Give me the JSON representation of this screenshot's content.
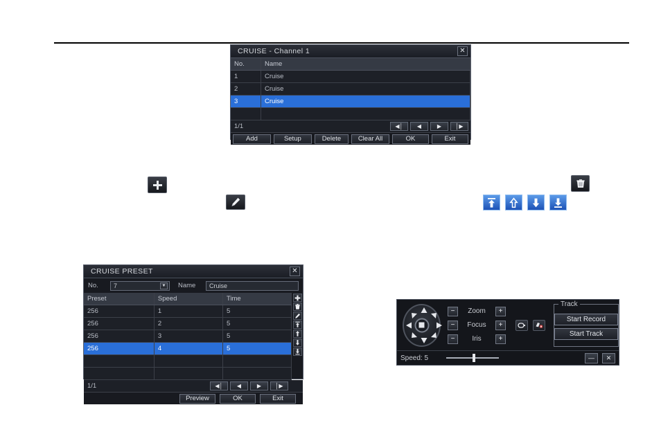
{
  "cruise_dialog": {
    "title": "CRUISE - Channel 1",
    "close_label": "✕",
    "columns": [
      "No.",
      "Name"
    ],
    "rows": [
      {
        "no": "1",
        "name": "Cruise",
        "selected": false
      },
      {
        "no": "2",
        "name": "Cruise",
        "selected": false
      },
      {
        "no": "3",
        "name": "Cruise",
        "selected": true
      },
      {
        "no": "",
        "name": "",
        "selected": false
      }
    ],
    "page_indicator": "1/1",
    "nav": {
      "first": "◀│",
      "prev": "◀",
      "next": "▶",
      "last": "│▶"
    },
    "buttons": {
      "add": "Add",
      "setup": "Setup",
      "delete": "Delete",
      "clear_all": "Clear All",
      "ok": "OK",
      "exit": "Exit"
    }
  },
  "standalone_icons": {
    "add": "plus-icon",
    "edit": "pencil-icon",
    "trash": "trash-icon",
    "move_top": "arrow-to-top-icon",
    "move_up": "arrow-up-icon",
    "move_down": "arrow-down-icon",
    "move_bottom": "arrow-to-bottom-icon"
  },
  "preset_dialog": {
    "title": "CRUISE PRESET",
    "close_label": "✕",
    "no_label": "No.",
    "no_value": "7",
    "name_label": "Name",
    "name_value": "Cruise",
    "columns": [
      "Preset",
      "Speed",
      "Time"
    ],
    "rows": [
      {
        "preset": "256",
        "speed": "1",
        "time": "5",
        "selected": false
      },
      {
        "preset": "256",
        "speed": "2",
        "time": "5",
        "selected": false
      },
      {
        "preset": "256",
        "speed": "3",
        "time": "5",
        "selected": false
      },
      {
        "preset": "256",
        "speed": "4",
        "time": "5",
        "selected": true
      },
      {
        "preset": "",
        "speed": "",
        "time": "",
        "selected": false
      },
      {
        "preset": "",
        "speed": "",
        "time": "",
        "selected": false
      }
    ],
    "page_indicator": "1/1",
    "nav": {
      "first": "◀│",
      "prev": "◀",
      "next": "▶",
      "last": "│▶"
    },
    "side_icons": [
      "plus-icon",
      "trash-icon",
      "pencil-icon",
      "arrow-to-top-icon",
      "arrow-up-icon",
      "arrow-down-icon",
      "arrow-to-bottom-icon"
    ],
    "buttons": {
      "preview": "Preview",
      "ok": "OK",
      "exit": "Exit"
    }
  },
  "ptz_panel": {
    "zoom_label": "Zoom",
    "focus_label": "Focus",
    "iris_label": "Iris",
    "minus_label": "−",
    "plus_label": "+",
    "track_legend": "Track",
    "start_record": "Start Record",
    "start_track": "Start Track",
    "speed_text": "Speed: 5",
    "speed_value": 5,
    "minimize_label": "—",
    "close_label": "✕",
    "light_icon": "light-icon",
    "wiper_icon": "wiper-icon",
    "joystick_icon": "joystick-stop-icon"
  },
  "colors": {
    "selection_blue": "#2a6fd8",
    "blue_button": "#3a7cd8",
    "panel_bg": "#181a20",
    "header_bg": "#353a44"
  }
}
